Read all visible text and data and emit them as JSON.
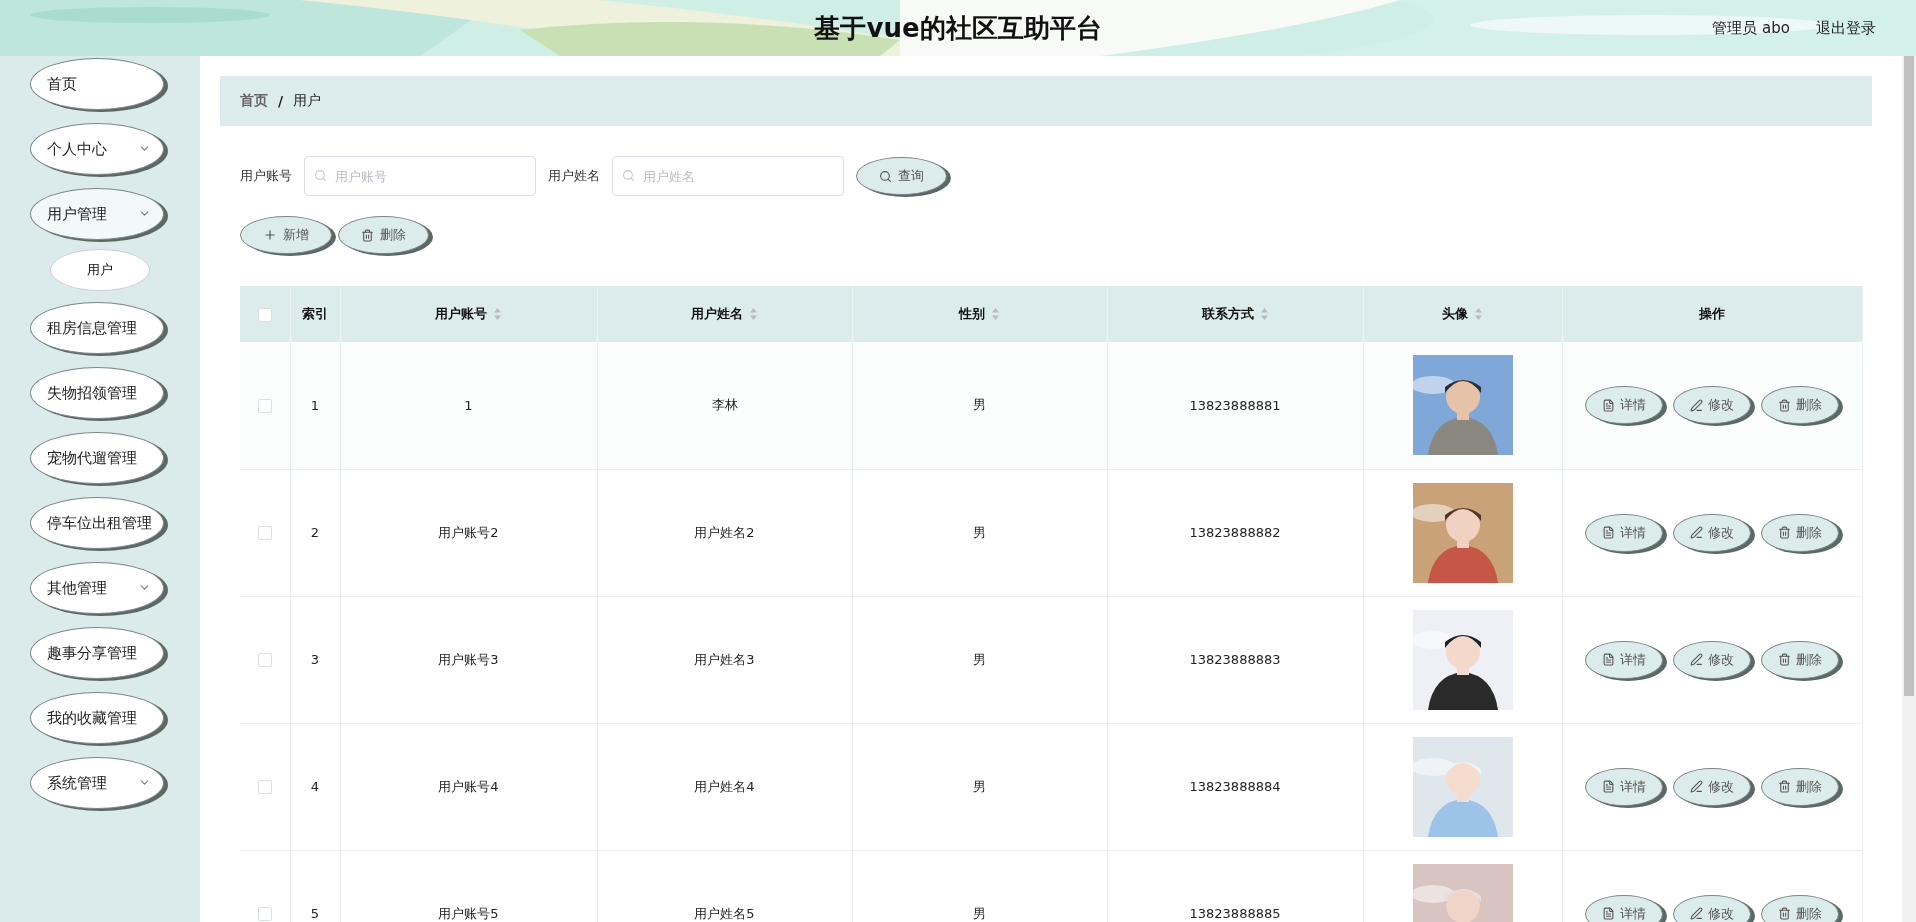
{
  "header": {
    "title": "基于vue的社区互助平台",
    "user": "管理员 abo",
    "logout": "退出登录"
  },
  "sidebar": {
    "items": [
      {
        "label": "首页",
        "expandable": false
      },
      {
        "label": "个人中心",
        "expandable": true
      },
      {
        "label": "用户管理",
        "expandable": true,
        "expanded": true,
        "children": [
          {
            "label": "用户",
            "selected": true
          }
        ]
      },
      {
        "label": "租房信息管理",
        "expandable": false
      },
      {
        "label": "失物招领管理",
        "expandable": false
      },
      {
        "label": "宠物代遛管理",
        "expandable": false
      },
      {
        "label": "停车位出租管理",
        "expandable": false
      },
      {
        "label": "其他管理",
        "expandable": true
      },
      {
        "label": "趣事分享管理",
        "expandable": false
      },
      {
        "label": "我的收藏管理",
        "expandable": false
      },
      {
        "label": "系统管理",
        "expandable": true
      }
    ]
  },
  "breadcrumb": [
    {
      "label": "首页"
    },
    {
      "label": "用户"
    }
  ],
  "breadcrumb_separator": "/",
  "search": {
    "fields": [
      {
        "label": "用户账号",
        "placeholder": "用户账号"
      },
      {
        "label": "用户姓名",
        "placeholder": "用户姓名"
      }
    ],
    "button": "查询"
  },
  "actions": [
    {
      "kind": "add",
      "label": "新增"
    },
    {
      "kind": "delete",
      "label": "删除"
    }
  ],
  "table": {
    "select_all_checked": false,
    "columns": [
      {
        "label": "索引",
        "sortable": false
      },
      {
        "label": "用户账号",
        "sortable": true
      },
      {
        "label": "用户姓名",
        "sortable": true
      },
      {
        "label": "性别",
        "sortable": true
      },
      {
        "label": "联系方式",
        "sortable": true
      },
      {
        "label": "头像",
        "sortable": true
      },
      {
        "label": "操作",
        "sortable": false
      }
    ],
    "rows": [
      {
        "checked": false,
        "index": "1",
        "account": "1",
        "name": "李林",
        "gender": "男",
        "phone": "13823888881",
        "actions": [
          {
            "kind": "detail",
            "label": "详情"
          },
          {
            "kind": "edit",
            "label": "修改"
          },
          {
            "kind": "delete",
            "label": "删除"
          }
        ]
      },
      {
        "checked": false,
        "index": "2",
        "account": "用户账号2",
        "name": "用户姓名2",
        "gender": "男",
        "phone": "13823888882",
        "actions": [
          {
            "kind": "detail",
            "label": "详情"
          },
          {
            "kind": "edit",
            "label": "修改"
          },
          {
            "kind": "delete",
            "label": "删除"
          }
        ]
      },
      {
        "checked": false,
        "index": "3",
        "account": "用户账号3",
        "name": "用户姓名3",
        "gender": "男",
        "phone": "13823888883",
        "actions": [
          {
            "kind": "detail",
            "label": "详情"
          },
          {
            "kind": "edit",
            "label": "修改"
          },
          {
            "kind": "delete",
            "label": "删除"
          }
        ]
      },
      {
        "checked": false,
        "index": "4",
        "account": "用户账号4",
        "name": "用户姓名4",
        "gender": "男",
        "phone": "13823888884",
        "actions": [
          {
            "kind": "detail",
            "label": "详情"
          },
          {
            "kind": "edit",
            "label": "修改"
          },
          {
            "kind": "delete",
            "label": "删除"
          }
        ]
      },
      {
        "checked": false,
        "index": "5",
        "account": "用户账号5",
        "name": "用户姓名5",
        "gender": "男",
        "phone": "13823888885",
        "actions": [
          {
            "kind": "detail",
            "label": "详情"
          },
          {
            "kind": "edit",
            "label": "修改"
          },
          {
            "kind": "delete",
            "label": "删除"
          }
        ]
      }
    ]
  }
}
